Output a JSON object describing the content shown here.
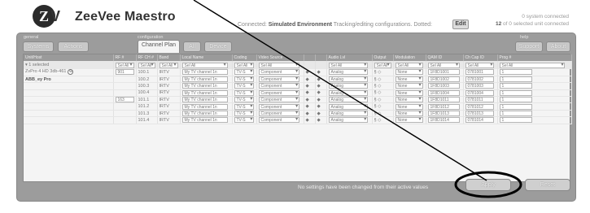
{
  "app": {
    "logo_letter": "Z",
    "logo_v": "V",
    "brand": "ZeeVee Maestro",
    "status_prefix": "Connected:",
    "status_env": "Simulated Environment",
    "status_suffix": "Tracking/editing configurations. Dotted:",
    "edit_label": "Edit",
    "sys_conn_line1": "0 system connected",
    "sys_conn_count": "12",
    "sys_conn_line2": "of 0 selected unit connected"
  },
  "groups": {
    "general": "general",
    "configuration": "configuration",
    "help": "help"
  },
  "tabs": [
    {
      "label": "Systems"
    },
    {
      "label": "Actions"
    },
    {
      "label": "Channel Plan"
    },
    {
      "label": "All"
    },
    {
      "label": "Device"
    },
    {
      "label": "Support"
    },
    {
      "label": "About"
    }
  ],
  "table": {
    "columns": [
      "Unit/Host",
      "RF #",
      "RF CH #",
      "Band",
      "Local Name",
      "Coding",
      "Video Source",
      "",
      "",
      "Audio Lvl",
      "Output",
      "Modulation",
      "QAM ID",
      "Ch Cap ID",
      "Prog #"
    ],
    "filter_label": "Sel All",
    "selected_label": "1 selected",
    "device_name": "ZvPro 4 HD 3db-461",
    "device_sub": "ABB_ey Pro",
    "rows": [
      {
        "rf": "901",
        "ch": "100.1",
        "band": "IRTV",
        "name": "My TV channel 1n",
        "coding": "TV-S",
        "source": "Component",
        "audio": "Analog",
        "mod": "None",
        "qam": "1F8D1001",
        "cap": "0781001",
        "prog": "1"
      },
      {
        "rf": "",
        "ch": "100.2",
        "band": "IRTV",
        "name": "My TV channel 1n",
        "coding": "TV-S",
        "source": "Component",
        "audio": "Analog",
        "mod": "None",
        "qam": "1F8D1002",
        "cap": "0781002",
        "prog": "1"
      },
      {
        "rf": "",
        "ch": "100.3",
        "band": "IRTV",
        "name": "My TV channel 1n",
        "coding": "TV-S",
        "source": "Component",
        "audio": "Analog",
        "mod": "None",
        "qam": "1F8D1003",
        "cap": "0781003",
        "prog": "1"
      },
      {
        "rf": "",
        "ch": "100.4",
        "band": "IRTV",
        "name": "My TV channel 1n",
        "coding": "TV-S",
        "source": "Component",
        "audio": "Analog",
        "mod": "None",
        "qam": "1F8D1004",
        "cap": "0781004",
        "prog": "1"
      },
      {
        "rf": "163",
        "ch": "101.1",
        "band": "IRTV",
        "name": "My TV channel 1n",
        "coding": "TV-S",
        "source": "Component",
        "audio": "Analog",
        "mod": "None",
        "qam": "1F8D1011",
        "cap": "0781011",
        "prog": "1"
      },
      {
        "rf": "",
        "ch": "101.2",
        "band": "IRTV",
        "name": "My TV channel 1n",
        "coding": "TV-S",
        "source": "Component",
        "audio": "Analog",
        "mod": "None",
        "qam": "1F8D1012",
        "cap": "0781012",
        "prog": "1"
      },
      {
        "rf": "",
        "ch": "101.3",
        "band": "IRTV",
        "name": "My TV channel 1n",
        "coding": "TV-S",
        "source": "Component",
        "audio": "Analog",
        "mod": "None",
        "qam": "1F8D1013",
        "cap": "0781013",
        "prog": "1"
      },
      {
        "rf": "",
        "ch": "101.4",
        "band": "IRTV",
        "name": "My TV channel 1n",
        "coding": "TV-S",
        "source": "Component",
        "audio": "Analog",
        "mod": "None",
        "qam": "1F8D1014",
        "cap": "0781014",
        "prog": "1"
      }
    ]
  },
  "footer": {
    "message": "No settings have been changed from their active values",
    "apply": "Apply",
    "reset": "Reset"
  }
}
